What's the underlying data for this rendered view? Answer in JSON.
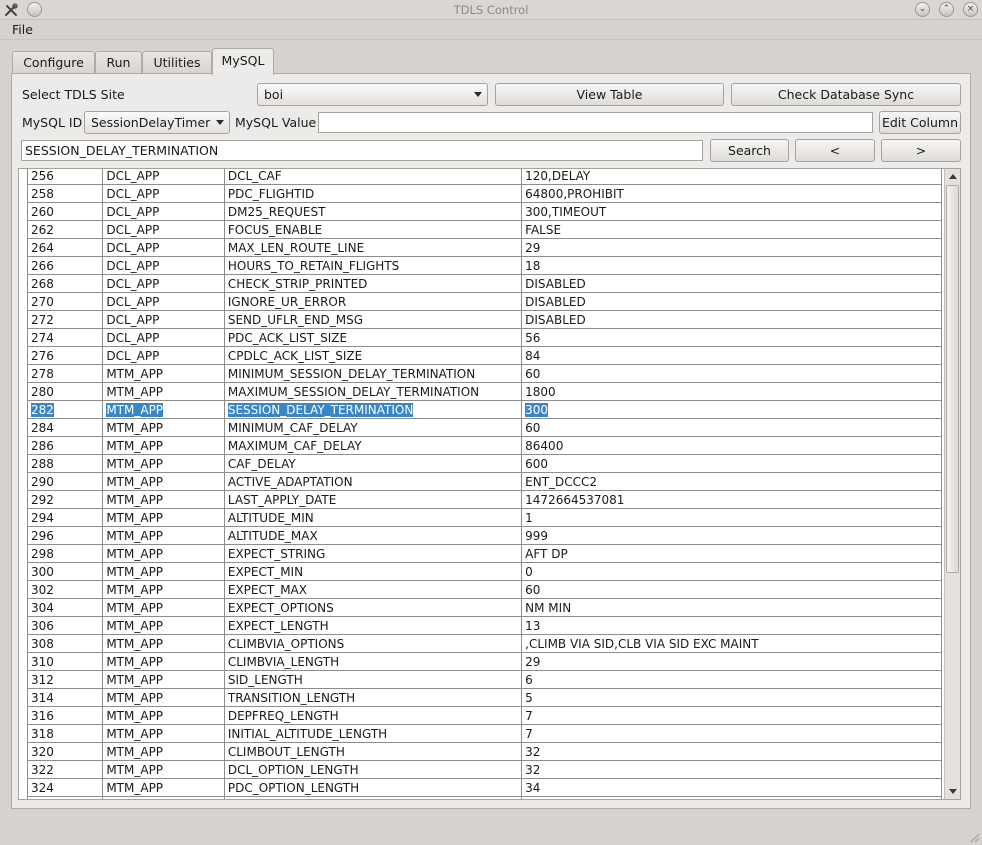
{
  "window": {
    "title": "TDLS Control"
  },
  "menu": {
    "file": "File"
  },
  "tabs": [
    {
      "label": "Configure"
    },
    {
      "label": "Run"
    },
    {
      "label": "Utilities"
    },
    {
      "label": "MySQL",
      "active": true
    }
  ],
  "controls": {
    "site_label": "Select TDLS Site",
    "site_value": "boi",
    "view_table": "View Table",
    "check_sync": "Check Database Sync",
    "mysql_id_label": "MySQL ID",
    "mysql_id_value": "SessionDelayTimer",
    "mysql_value_label": "MySQL Value",
    "mysql_value": "",
    "edit_column": "Edit Column",
    "search_text": "SESSION_DELAY_TERMINATION",
    "search": "Search",
    "prev": "<",
    "next": ">"
  },
  "colors": {
    "selection": "#3a87c8",
    "panel": "#edebe9",
    "window": "#d6d2d0"
  },
  "table": {
    "selected_id": "282",
    "rows": [
      [
        "256",
        "DCL_APP",
        "DCL_CAF",
        "120,DELAY"
      ],
      [
        "258",
        "DCL_APP",
        "PDC_FLIGHTID",
        "64800,PROHIBIT"
      ],
      [
        "260",
        "DCL_APP",
        "DM25_REQUEST",
        "300,TIMEOUT"
      ],
      [
        "262",
        "DCL_APP",
        "FOCUS_ENABLE",
        "FALSE"
      ],
      [
        "264",
        "DCL_APP",
        "MAX_LEN_ROUTE_LINE",
        "29"
      ],
      [
        "266",
        "DCL_APP",
        "HOURS_TO_RETAIN_FLIGHTS",
        "18"
      ],
      [
        "268",
        "DCL_APP",
        "CHECK_STRIP_PRINTED",
        "DISABLED"
      ],
      [
        "270",
        "DCL_APP",
        "IGNORE_UR_ERROR",
        "DISABLED"
      ],
      [
        "272",
        "DCL_APP",
        "SEND_UFLR_END_MSG",
        "DISABLED"
      ],
      [
        "274",
        "DCL_APP",
        "PDC_ACK_LIST_SIZE",
        "56"
      ],
      [
        "276",
        "DCL_APP",
        "CPDLC_ACK_LIST_SIZE",
        "84"
      ],
      [
        "278",
        "MTM_APP",
        "MINIMUM_SESSION_DELAY_TERMINATION",
        "60"
      ],
      [
        "280",
        "MTM_APP",
        "MAXIMUM_SESSION_DELAY_TERMINATION",
        "1800"
      ],
      [
        "282",
        "MTM_APP",
        "SESSION_DELAY_TERMINATION",
        "300"
      ],
      [
        "284",
        "MTM_APP",
        "MINIMUM_CAF_DELAY",
        "60"
      ],
      [
        "286",
        "MTM_APP",
        "MAXIMUM_CAF_DELAY",
        "86400"
      ],
      [
        "288",
        "MTM_APP",
        "CAF_DELAY",
        "600"
      ],
      [
        "290",
        "MTM_APP",
        "ACTIVE_ADAPTATION",
        "ENT_DCCC2"
      ],
      [
        "292",
        "MTM_APP",
        "LAST_APPLY_DATE",
        "1472664537081"
      ],
      [
        "294",
        "MTM_APP",
        "ALTITUDE_MIN",
        "1"
      ],
      [
        "296",
        "MTM_APP",
        "ALTITUDE_MAX",
        "999"
      ],
      [
        "298",
        "MTM_APP",
        "EXPECT_STRING",
        "AFT DP"
      ],
      [
        "300",
        "MTM_APP",
        "EXPECT_MIN",
        "0"
      ],
      [
        "302",
        "MTM_APP",
        "EXPECT_MAX",
        "60"
      ],
      [
        "304",
        "MTM_APP",
        "EXPECT_OPTIONS",
        "NM MIN"
      ],
      [
        "306",
        "MTM_APP",
        "EXPECT_LENGTH",
        "13"
      ],
      [
        "308",
        "MTM_APP",
        "CLIMBVIA_OPTIONS",
        ",CLIMB VIA SID,CLB VIA SID EXC MAINT"
      ],
      [
        "310",
        "MTM_APP",
        "CLIMBVIA_LENGTH",
        "29"
      ],
      [
        "312",
        "MTM_APP",
        "SID_LENGTH",
        "6"
      ],
      [
        "314",
        "MTM_APP",
        "TRANSITION_LENGTH",
        "5"
      ],
      [
        "316",
        "MTM_APP",
        "DEPFREQ_LENGTH",
        "7"
      ],
      [
        "318",
        "MTM_APP",
        "INITIAL_ALTITUDE_LENGTH",
        "7"
      ],
      [
        "320",
        "MTM_APP",
        "CLIMBOUT_LENGTH",
        "32"
      ],
      [
        "322",
        "MTM_APP",
        "DCL_OPTION_LENGTH",
        "32"
      ],
      [
        "324",
        "MTM_APP",
        "PDC_OPTION_LENGTH",
        "34"
      ],
      [
        "",
        "",
        "",
        ""
      ]
    ]
  }
}
